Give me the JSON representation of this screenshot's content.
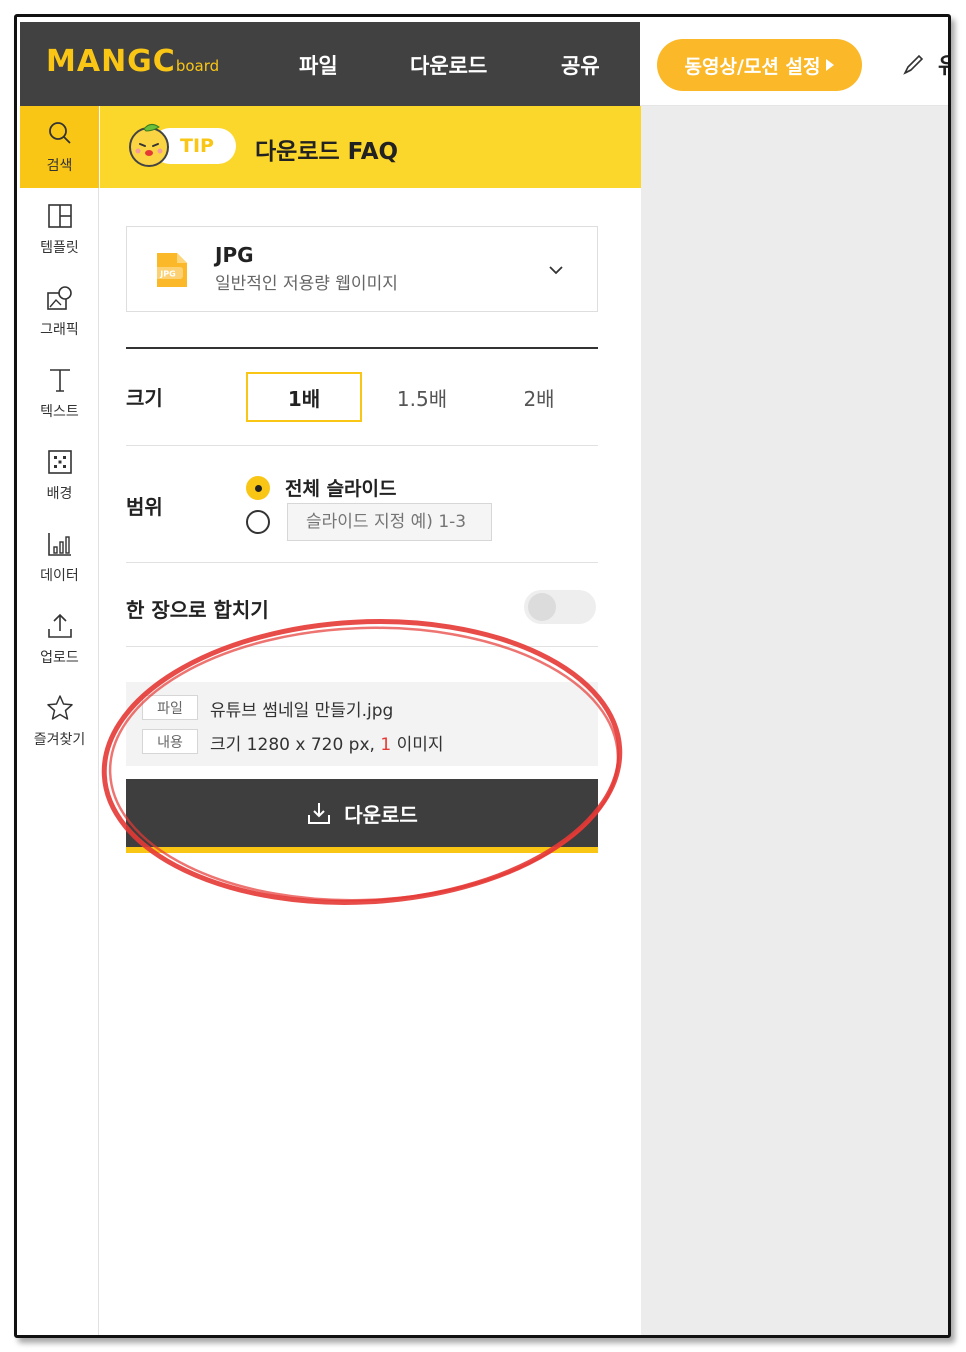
{
  "app": {
    "logo_main": "MANGC",
    "logo_sub": "board",
    "menu": [
      "파일",
      "다운로드",
      "공유"
    ],
    "motion_button": "동영상/모션 설정",
    "truncated_label": "유"
  },
  "sidebar": {
    "items": [
      {
        "label": "검색",
        "icon": "search-icon"
      },
      {
        "label": "템플릿",
        "icon": "template-icon"
      },
      {
        "label": "그래픽",
        "icon": "graphic-icon"
      },
      {
        "label": "텍스트",
        "icon": "text-icon"
      },
      {
        "label": "배경",
        "icon": "background-icon"
      },
      {
        "label": "데이터",
        "icon": "chart-icon"
      },
      {
        "label": "업로드",
        "icon": "upload-icon"
      },
      {
        "label": "즐겨찾기",
        "icon": "star-icon"
      }
    ]
  },
  "panel": {
    "tip_badge": "TIP",
    "tip_title": "다운로드 FAQ",
    "format": {
      "name": "JPG",
      "description": "일반적인 저용량 웹이미지",
      "icon_text": "JPG"
    },
    "size": {
      "label": "크기",
      "options": [
        "1배",
        "1.5배",
        "2배"
      ],
      "selected": "1배"
    },
    "range": {
      "label": "범위",
      "all_slides": "전체 슬라이드",
      "custom_placeholder": "슬라이드 지정 예) 1-3"
    },
    "merge": {
      "label": "한 장으로 합치기",
      "enabled": false
    },
    "info": {
      "file_tag": "파일",
      "file_name": "유튜브 썸네일 만들기.jpg",
      "content_tag": "내용",
      "content_prefix": "크기 1280 x 720 px,",
      "content_count": "1",
      "content_suffix": "이미지"
    },
    "download_button": "다운로드"
  },
  "colors": {
    "accent": "#f9c616",
    "topbar": "#414141",
    "annotation": "#e53935"
  }
}
